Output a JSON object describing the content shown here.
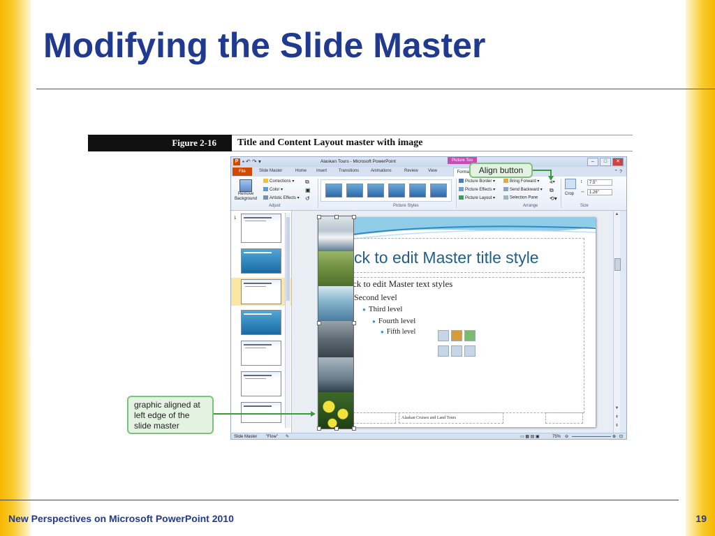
{
  "slide": {
    "title": "Modifying the Slide Master",
    "footer": "New Perspectives on Microsoft PowerPoint 2010",
    "page_number": "19"
  },
  "figure": {
    "label": "Figure 2-16",
    "caption": "Title and Content Layout master with image"
  },
  "window": {
    "title": "Alaskan Tours - Microsoft PowerPoint",
    "context_tab": "Picture Too"
  },
  "tabs": [
    "File",
    "Slide Master",
    "Home",
    "Insert",
    "Transitions",
    "Animations",
    "Review",
    "View",
    "Format"
  ],
  "ribbon": {
    "remove_background": "Remove Background",
    "corrections": "Corrections",
    "color": "Color",
    "artistic_effects": "Artistic Effects",
    "adjust_label": "Adjust",
    "picture_styles_label": "Picture Styles",
    "picture_border": "Picture Border",
    "picture_effects": "Picture Effects",
    "picture_layout": "Picture Layout",
    "bring_forward": "Bring Forward",
    "send_backward": "Send Backward",
    "selection_pane": "Selection Pane",
    "arrange_label": "Arrange",
    "crop": "Crop",
    "height": "7.5\"",
    "width": "1.26\"",
    "size_label": "Size"
  },
  "master": {
    "title_text": "ck to edit Master title style",
    "level1": "ck to edit Master text styles",
    "level2": "Second level",
    "level3": "Third level",
    "level4": "Fourth level",
    "level5": "Fifth level",
    "footer_text": "Alaskan Cruises and Land Tours"
  },
  "thumbnail_number": "1",
  "statusbar": {
    "view": "Slide Master",
    "theme": "\"Flow\"",
    "zoom": "75%"
  },
  "callouts": {
    "align_button": "Align button",
    "graphic_aligned": "graphic aligned at left edge of the slide master"
  },
  "colors": {
    "title_blue": "#1f3a8f",
    "callout_fill": "#e4f3e1",
    "callout_border": "#7cc27c",
    "accent_orange": "#d04a02",
    "gold_bar": "#f6b800"
  }
}
